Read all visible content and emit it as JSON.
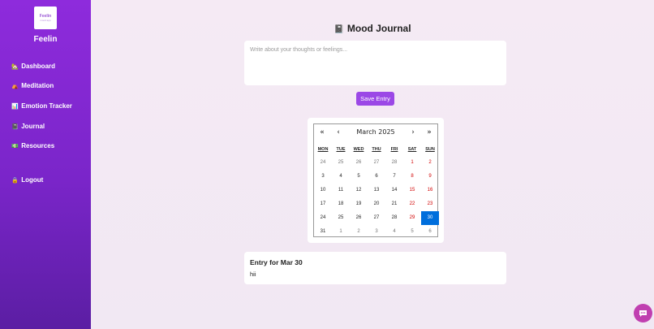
{
  "sidebar": {
    "logo_text": "Feelin",
    "logo_sub": "mood app",
    "brand": "Feelin",
    "items": [
      {
        "icon": "🏡",
        "label": "Dashboard"
      },
      {
        "icon": "⛺",
        "label": "Meditation"
      },
      {
        "icon": "📊",
        "label": "Emotion Tracker"
      },
      {
        "icon": "📓",
        "label": "Journal"
      },
      {
        "icon": "💵",
        "label": "Resources"
      }
    ],
    "logout": {
      "icon": "🔒",
      "label": "Logout"
    }
  },
  "page": {
    "title_icon": "📓",
    "title": "Mood Journal"
  },
  "journal": {
    "placeholder": "Write about your thoughts or feelings...",
    "value": "",
    "save_label": "Save Entry"
  },
  "calendar": {
    "nav_first": "«",
    "nav_prev": "‹",
    "month_label": "March 2025",
    "nav_next": "›",
    "nav_last": "»",
    "weekdays": [
      "MON",
      "TUE",
      "WED",
      "THU",
      "FRI",
      "SAT",
      "SUN"
    ],
    "days": [
      {
        "n": "24",
        "other": true
      },
      {
        "n": "25",
        "other": true
      },
      {
        "n": "26",
        "other": true
      },
      {
        "n": "27",
        "other": true
      },
      {
        "n": "28",
        "other": true
      },
      {
        "n": "1"
      },
      {
        "n": "2"
      },
      {
        "n": "3"
      },
      {
        "n": "4"
      },
      {
        "n": "5"
      },
      {
        "n": "6"
      },
      {
        "n": "7"
      },
      {
        "n": "8"
      },
      {
        "n": "9"
      },
      {
        "n": "10"
      },
      {
        "n": "11"
      },
      {
        "n": "12"
      },
      {
        "n": "13"
      },
      {
        "n": "14"
      },
      {
        "n": "15"
      },
      {
        "n": "16"
      },
      {
        "n": "17"
      },
      {
        "n": "18"
      },
      {
        "n": "19"
      },
      {
        "n": "20"
      },
      {
        "n": "21"
      },
      {
        "n": "22"
      },
      {
        "n": "23"
      },
      {
        "n": "24"
      },
      {
        "n": "25"
      },
      {
        "n": "26"
      },
      {
        "n": "27"
      },
      {
        "n": "28"
      },
      {
        "n": "29"
      },
      {
        "n": "30",
        "selected": true
      },
      {
        "n": "31"
      },
      {
        "n": "1",
        "other": true
      },
      {
        "n": "2",
        "other": true
      },
      {
        "n": "3",
        "other": true
      },
      {
        "n": "4",
        "other": true
      },
      {
        "n": "5",
        "other": true
      },
      {
        "n": "6",
        "other": true
      }
    ],
    "selected_color": "#006edc",
    "weekend_color": "#d10000"
  },
  "entry": {
    "title": "Entry for Mar 30",
    "body": "hii"
  },
  "colors": {
    "accent": "#9b48e6",
    "sidebar_top": "#8e2bdc",
    "chat_button": "#c03fb0"
  }
}
